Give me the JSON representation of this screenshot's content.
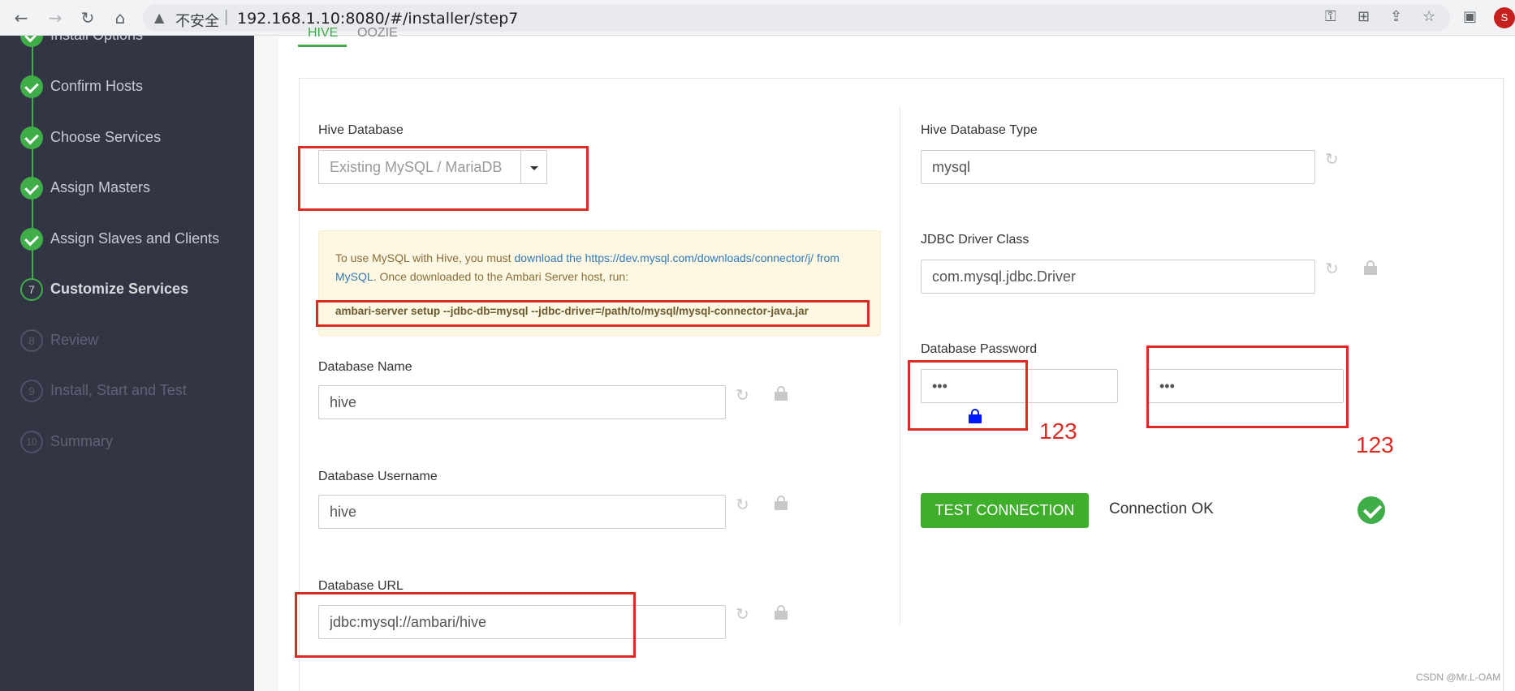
{
  "browser": {
    "security_label": "不安全",
    "url": "192.168.1.10:8080/#/installer/step7",
    "profile_initial": "S"
  },
  "sidebar": {
    "steps": [
      {
        "number": "",
        "label": "Install Options",
        "state": "done"
      },
      {
        "number": "",
        "label": "Confirm Hosts",
        "state": "done"
      },
      {
        "number": "",
        "label": "Choose Services",
        "state": "done"
      },
      {
        "number": "",
        "label": "Assign Masters",
        "state": "done"
      },
      {
        "number": "",
        "label": "Assign Slaves and Clients",
        "state": "done"
      },
      {
        "number": "7",
        "label": "Customize Services",
        "state": "current"
      },
      {
        "number": "8",
        "label": "Review",
        "state": "future"
      },
      {
        "number": "9",
        "label": "Install, Start and Test",
        "state": "future"
      },
      {
        "number": "10",
        "label": "Summary",
        "state": "future"
      }
    ]
  },
  "tabs": {
    "hive": "HIVE",
    "oozie": "OOZIE"
  },
  "left": {
    "hive_database_label": "Hive Database",
    "hive_database_value": "Existing MySQL / MariaDB",
    "alert_text_1": "To use MySQL with Hive, you must ",
    "alert_link": "download the https://dev.mysql.com/downloads/connector/j/ from MySQL",
    "alert_text_2": ". Once downloaded to the Ambari Server host, run:",
    "alert_command": "ambari-server setup --jdbc-db=mysql --jdbc-driver=/path/to/mysql/mysql-connector-java.jar",
    "db_name_label": "Database Name",
    "db_name_value": "hive",
    "db_username_label": "Database Username",
    "db_username_value": "hive",
    "db_url_label": "Database URL",
    "db_url_value": "jdbc:mysql://ambari/hive"
  },
  "right": {
    "db_type_label": "Hive Database Type",
    "db_type_value": "mysql",
    "jdbc_driver_label": "JDBC Driver Class",
    "jdbc_driver_value": "com.mysql.jdbc.Driver",
    "db_password_label": "Database Password",
    "db_password_value": "•••",
    "db_password_confirm_value": "•••",
    "test_button": "TEST CONNECTION",
    "connection_status": "Connection OK"
  },
  "annotations": {
    "note_1": "123",
    "note_2": "123"
  },
  "watermark": "CSDN @Mr.L-OAM",
  "colors": {
    "accent_green": "#3fae49",
    "button_green": "#3fae2a",
    "sidebar_bg": "#323544",
    "annotation_red": "#dc2b23",
    "lock_blue": "#0018f5"
  }
}
